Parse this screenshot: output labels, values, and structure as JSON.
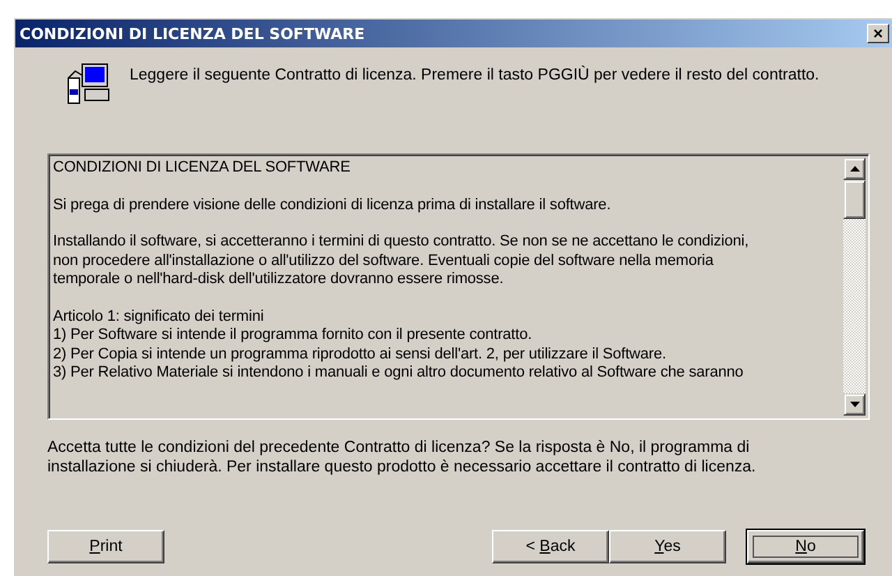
{
  "window": {
    "title": "CONDIZIONI DI LICENZA DEL SOFTWARE",
    "close": "×"
  },
  "header": {
    "text": "Leggere il seguente Contratto di licenza. Premere il tasto PGGIÙ per vedere il resto del contratto."
  },
  "license_text": [
    {
      "lines": [
        "CONDIZIONI DI LICENZA DEL SOFTWARE"
      ]
    },
    {
      "lines": [
        "Si prega di prendere visione delle condizioni di licenza prima di installare il software."
      ]
    },
    {
      "lines": [
        "Installando il software, si accetteranno i termini di questo contratto. Se non se ne accettano le condizioni,",
        "non procedere all'installazione o all'utilizzo del software. Eventuali copie del software nella memoria",
        "temporale o nell'hard-disk dell'utilizzatore dovranno essere rimosse."
      ]
    },
    {
      "lines": [
        "Articolo 1: significato dei termini",
        "1) Per Software si intende il programma fornito con il presente contratto.",
        "2) Per Copia si intende un programma riprodotto ai sensi dell'art. 2, per utilizzare il Software.",
        "3) Per Relativo Materiale si intendono i manuali e ogni altro documento relativo al Software che saranno"
      ]
    }
  ],
  "question": {
    "text": "Accetta tutte le condizioni del precedente Contratto di licenza? Se la risposta è No, il programma di installazione si chiuderà. Per installare questo prodotto è necessario accettare il contratto di licenza."
  },
  "print_button": {
    "key": "P",
    "after": "rint",
    "default": false
  },
  "buttons": [
    {
      "before": "< ",
      "key": "B",
      "after": "ack",
      "default": false
    },
    {
      "key": "Y",
      "after": "es",
      "default": false
    },
    {
      "key": "N",
      "after": "o",
      "default": true
    }
  ]
}
